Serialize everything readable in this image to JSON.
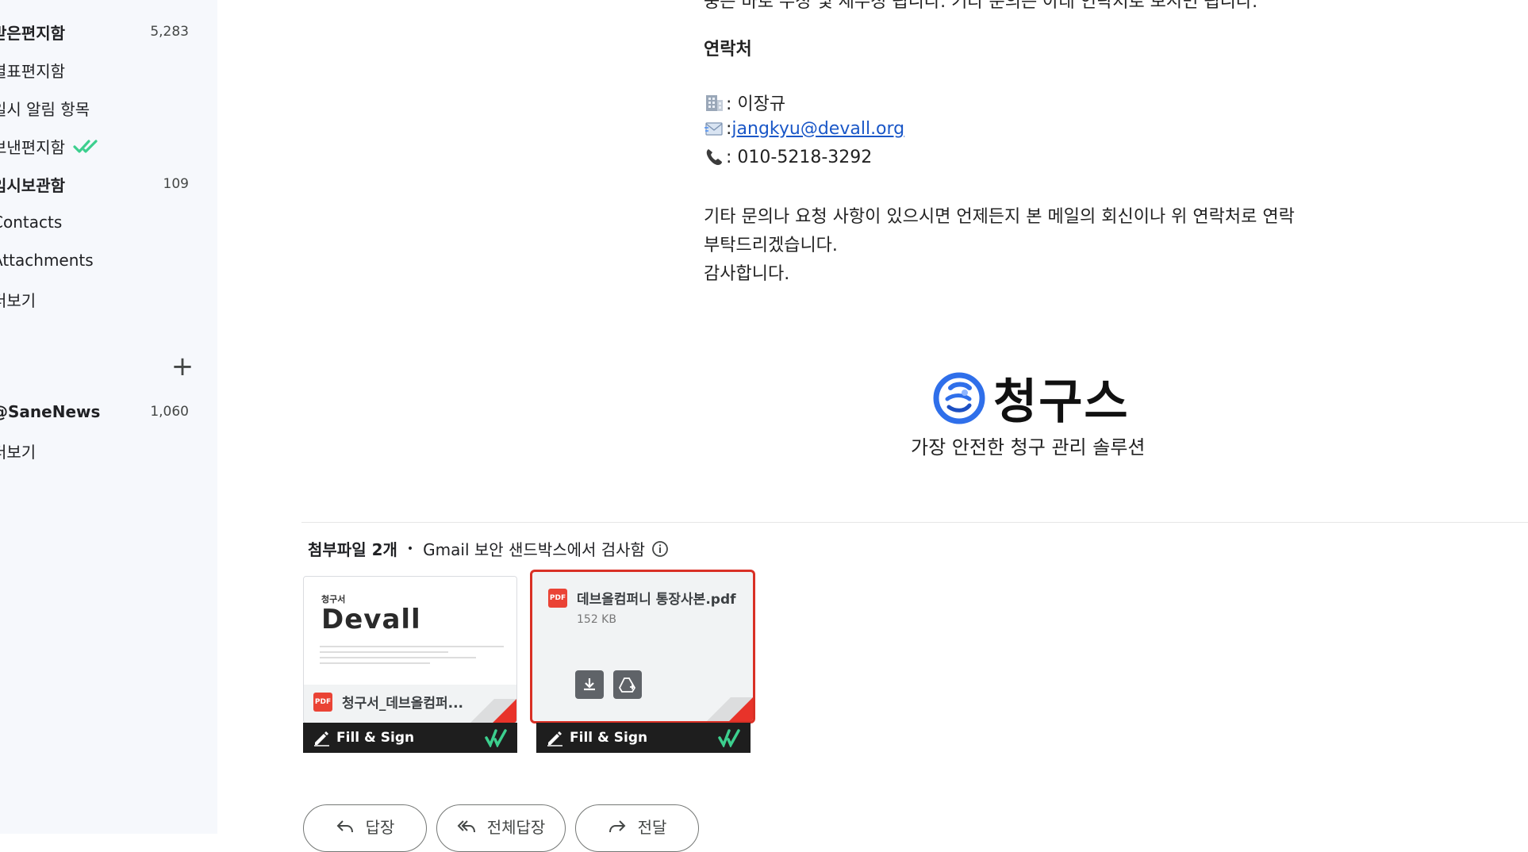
{
  "sidebar": {
    "items": [
      {
        "label": "받은편지함",
        "count": "5,283",
        "bold": true
      },
      {
        "label": "별표편지함",
        "count": "",
        "bold": false
      },
      {
        "label": "일시 알림 항목",
        "count": "",
        "bold": false
      },
      {
        "label": "보낸편지함",
        "count": "",
        "bold": false
      },
      {
        "label": "임시보관함",
        "count": "109",
        "bold": true
      },
      {
        "label": "Contacts",
        "count": "",
        "bold": false
      },
      {
        "label": "Attachments",
        "count": "",
        "bold": false
      },
      {
        "label": "더보기",
        "count": "",
        "bold": false
      }
    ],
    "labels": [
      {
        "label": "@SaneNews",
        "count": "1,060",
        "bold": true
      },
      {
        "label": "더보기",
        "count": "",
        "bold": false
      }
    ]
  },
  "email": {
    "cut_line": "중은 바로 수정 및 재수정 됩니다. 기타 문의는 아래 연락처로 보시면 됩니다.",
    "contact_heading": "연락처",
    "contact_name": ": 이장규",
    "contact_email_prefix": ": ",
    "contact_email": "jangkyu@devall.org",
    "contact_phone": ": 010-5218-3292",
    "closing_1": "기타 문의나 요청 사항이 있으시면 언제든지 본 메일의 회신이나 위 연락처로 연락",
    "closing_2": "부탁드리겠습니다.",
    "closing_3": "감사합니다.",
    "logo_text": "청구스",
    "logo_tagline": "가장 안전한 청구 관리 솔루션"
  },
  "attachments": {
    "count_label": "첨부파일 2개",
    "scan_note": "Gmail 보안 샌드박스에서 검사함",
    "files": [
      {
        "name": "청구서_데브올컴퍼...",
        "thumb_title": "청구서",
        "thumb_brand": "Devall"
      },
      {
        "name": "데브올컴퍼니 통장사본.pdf",
        "size": "152 KB"
      }
    ],
    "fill_sign_label": "Fill & Sign",
    "pdf_badge": "PDF"
  },
  "actions": {
    "reply": "답장",
    "reply_all": "전체답장",
    "forward": "전달"
  },
  "colors": {
    "sidebar_bg": "#f6f8fc",
    "link": "#1a57c7",
    "selected_border": "#d93025",
    "accent_green": "#3ccf8e",
    "logo_blue": "#2f6fea"
  }
}
